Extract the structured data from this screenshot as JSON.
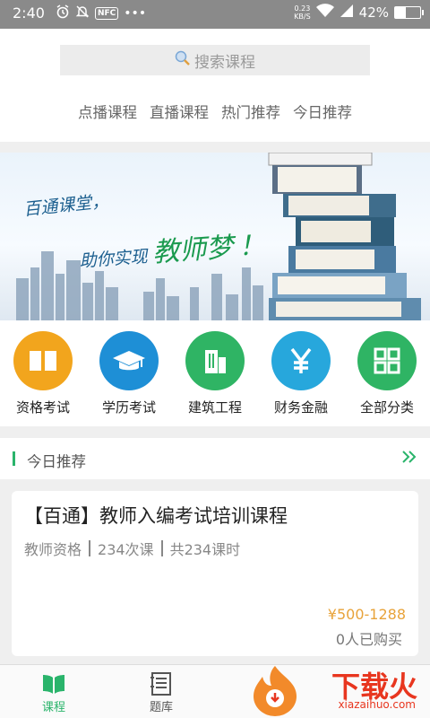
{
  "status_bar": {
    "time": "2:40",
    "nfc": "NFC",
    "dots": "•••",
    "net_speed_value": "0.23",
    "net_speed_unit": "KB/S",
    "battery_percent": "42%",
    "battery_level": 0.42
  },
  "search": {
    "icon": "search-icon",
    "placeholder": "搜索课程"
  },
  "nav_tabs": [
    "点播课程",
    "直播课程",
    "热门推荐",
    "今日推荐"
  ],
  "banner": {
    "line1": "百通课堂，",
    "line2_prefix": "助你实现",
    "line2_highlight": "教师梦",
    "line2_suffix": "！"
  },
  "categories": [
    {
      "label": "资格考试",
      "icon": "book-icon",
      "color": "#f2a51d"
    },
    {
      "label": "学历考试",
      "icon": "graduation-cap-icon",
      "color": "#1e8fd6"
    },
    {
      "label": "建筑工程",
      "icon": "building-icon",
      "color": "#2fb464"
    },
    {
      "label": "财务金融",
      "icon": "yen-icon",
      "color": "#27a7dc"
    },
    {
      "label": "全部分类",
      "icon": "grid-icon",
      "color": "#2fb464"
    }
  ],
  "section": {
    "title": "今日推荐",
    "more_icon": "double-chevron-right-icon"
  },
  "course": {
    "title": "【百通】教师入编考试培训课程",
    "meta": [
      "教师资格",
      "234次课",
      "共234课时"
    ],
    "price": "¥500-1288",
    "buyers": "0人已购买"
  },
  "tabs": [
    {
      "label": "课程",
      "icon": "course-icon",
      "active": true
    },
    {
      "label": "题库",
      "icon": "question-bank-icon",
      "active": false
    }
  ],
  "watermark": {
    "brand": "下载火",
    "url": "xiazaihuo.com"
  },
  "colors": {
    "accent": "#2ab46b",
    "price": "#e8a33a"
  }
}
